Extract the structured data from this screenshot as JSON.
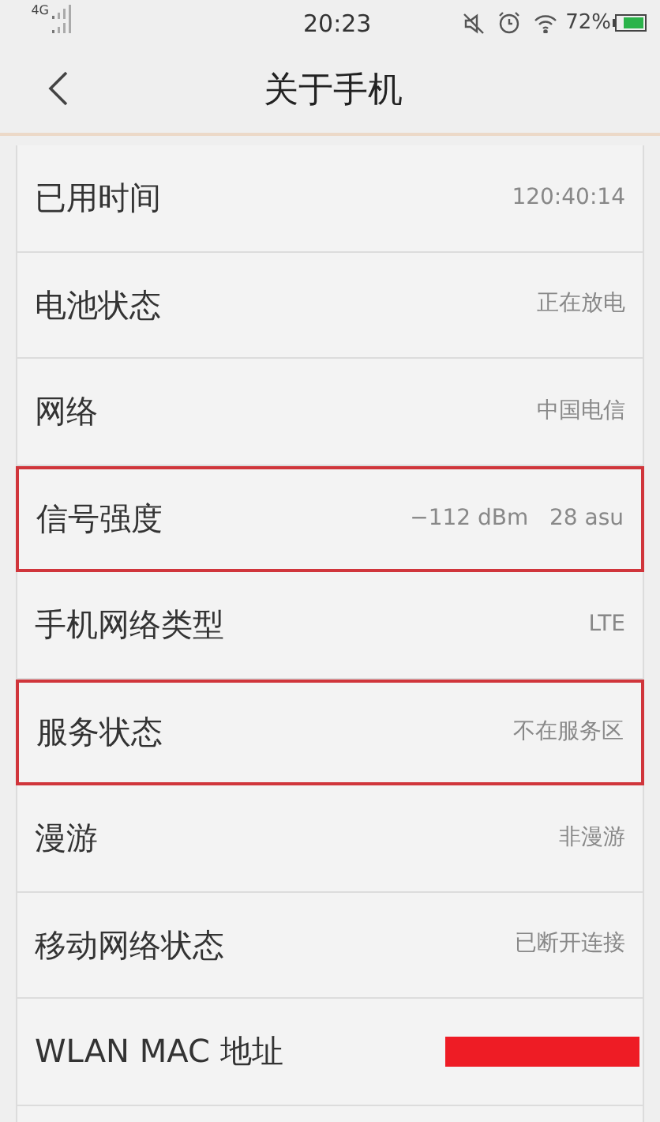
{
  "status_bar": {
    "network": "4G",
    "time": "20:23",
    "battery": "72%"
  },
  "header": {
    "title": "关于手机"
  },
  "rows": [
    {
      "label": "已用时间",
      "value": "120:40:14",
      "highlighted": false,
      "redacted": false
    },
    {
      "label": "电池状态",
      "value": "正在放电",
      "highlighted": false,
      "redacted": false
    },
    {
      "label": "网络",
      "value": "中国电信",
      "highlighted": false,
      "redacted": false
    },
    {
      "label": "信号强度",
      "value": "−112 dBm   28 asu",
      "highlighted": true,
      "redacted": false
    },
    {
      "label": "手机网络类型",
      "value": "LTE",
      "highlighted": false,
      "redacted": false
    },
    {
      "label": "服务状态",
      "value": "不在服务区",
      "highlighted": true,
      "redacted": false
    },
    {
      "label": "漫游",
      "value": "非漫游",
      "highlighted": false,
      "redacted": false
    },
    {
      "label": "移动网络状态",
      "value": "已断开连接",
      "highlighted": false,
      "redacted": false
    },
    {
      "label": "WLAN MAC 地址",
      "highlighted": false,
      "redacted": true
    }
  ]
}
